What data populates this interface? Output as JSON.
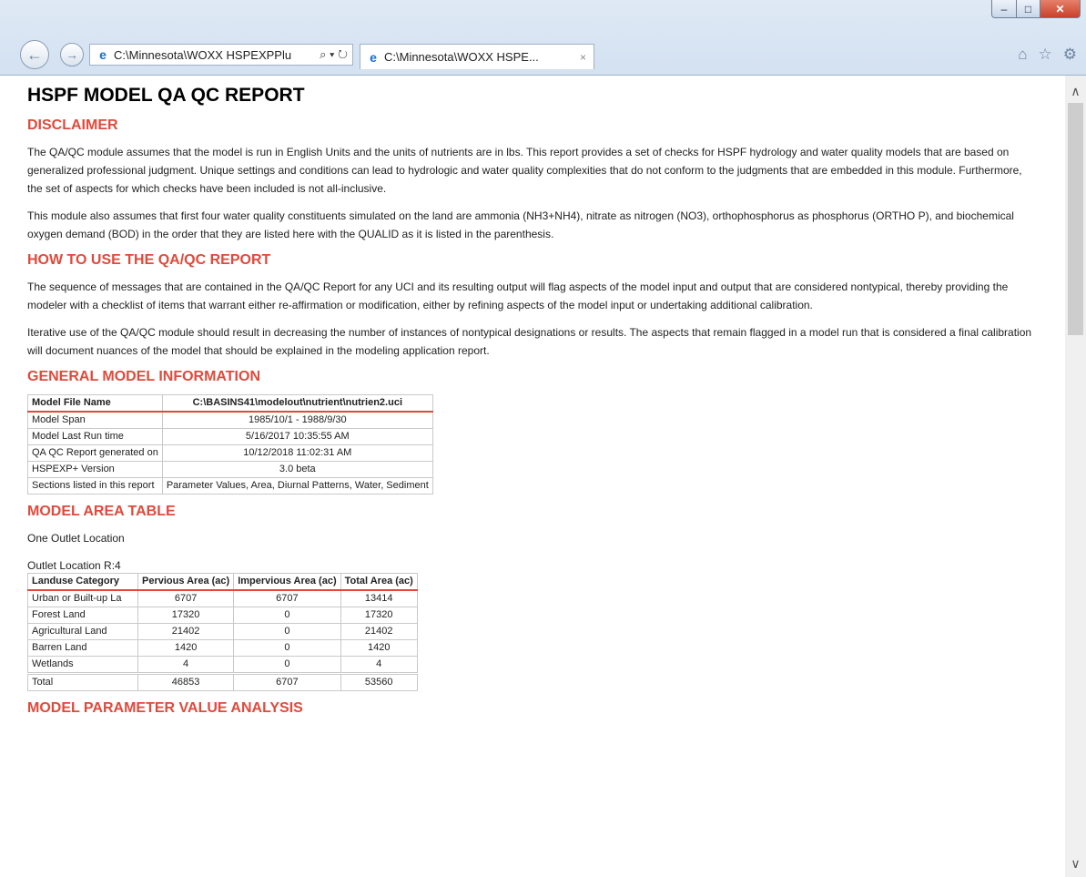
{
  "browser": {
    "address": "C:\\Minnesota\\WOXX HSPEXPPlu",
    "address_tools": "⌕ ▾ ↻",
    "tab_title": "C:\\Minnesota\\WOXX HSPE...",
    "tab_close": "×",
    "min_glyph": "‒",
    "max_glyph": "□",
    "close_glyph": "✕",
    "back_glyph": "←",
    "fwd_glyph": "→",
    "ie_glyph": "e",
    "home_glyph": "⌂",
    "star_glyph": "☆",
    "gear_glyph": "⚙",
    "scroll_up_glyph": "∧",
    "scroll_down_glyph": "∨"
  },
  "report": {
    "title": "HSPF MODEL QA QC REPORT",
    "disclaimer_heading": "DISCLAIMER",
    "disclaimer_p1": "The QA/QC module assumes that the model is run in English Units and the units of nutrients are in lbs. This report provides a set of checks for HSPF hydrology and water quality models that are based on generalized professional judgment. Unique settings and conditions can lead to hydrologic and water quality complexities that do not conform to the judgments that are embedded in this module. Furthermore, the set of aspects for which checks have been included is not all-inclusive.",
    "disclaimer_p2": "This module also assumes that first four water quality constituents simulated on the land are ammonia (NH3+NH4), nitrate as nitrogen (NO3), orthophosphorus as phosphorus (ORTHO P), and biochemical oxygen demand (BOD) in the order that they are listed here with the QUALID as it is listed in the parenthesis.",
    "howto_heading": "HOW TO USE THE QA/QC REPORT",
    "howto_p1": "The sequence of messages that are contained in the QA/QC Report for any UCI and its resulting output will flag aspects of the model input and output that are considered nontypical, thereby providing the modeler with a checklist of items that warrant either re-affirmation or modification, either by refining aspects of the model input or undertaking additional calibration.",
    "howto_p2": "Iterative use of the QA/QC module should result in decreasing the number of instances of nontypical designations or results. The aspects that remain flagged in a model run that is considered a final calibration will document nuances of the model that should be explained in the modeling application report.",
    "general_heading": "GENERAL MODEL INFORMATION",
    "general_table": {
      "header": [
        "Model File Name",
        "C:\\BASINS41\\modelout\\nutrient\\nutrien2.uci"
      ],
      "rows": [
        [
          "Model Span",
          "1985/10/1 - 1988/9/30"
        ],
        [
          "Model Last Run time",
          "5/16/2017 10:35:55 AM"
        ],
        [
          "QA QC Report generated on",
          "10/12/2018 11:02:31 AM"
        ],
        [
          "HSPEXP+ Version",
          "3.0 beta"
        ],
        [
          "Sections listed in this report",
          "Parameter Values, Area, Diurnal Patterns, Water, Sediment"
        ]
      ]
    },
    "area_heading": "MODEL AREA TABLE",
    "outlet_text": "One Outlet Location",
    "outlet_location": "Outlet Location R:4",
    "area_table": {
      "header": [
        "Landuse Category",
        "Pervious Area (ac)",
        "Impervious Area (ac)",
        "Total Area (ac)"
      ],
      "rows": [
        [
          "Urban or Built-up La",
          "6707",
          "6707",
          "13414"
        ],
        [
          "Forest Land",
          "17320",
          "0",
          "17320"
        ],
        [
          "Agricultural Land",
          "21402",
          "0",
          "21402"
        ],
        [
          "Barren Land",
          "1420",
          "0",
          "1420"
        ],
        [
          "Wetlands",
          "4",
          "0",
          "4"
        ]
      ],
      "total": [
        "Total",
        "46853",
        "6707",
        "53560"
      ]
    },
    "param_heading": "MODEL PARAMETER VALUE ANALYSIS"
  }
}
